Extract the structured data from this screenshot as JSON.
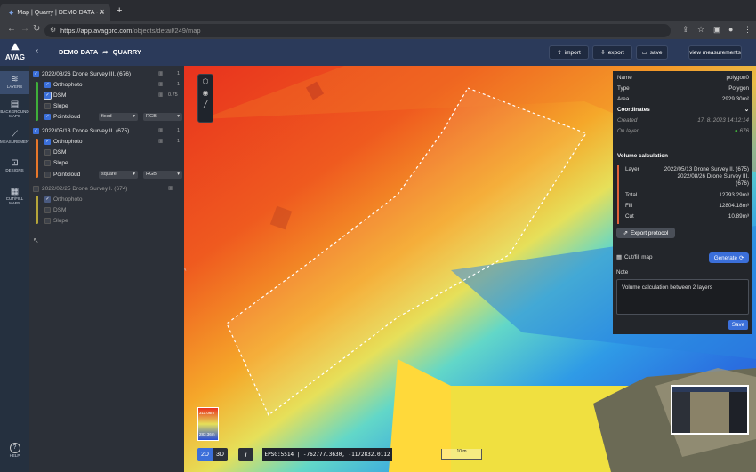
{
  "browser": {
    "tab_title": "Map | Quarry | DEMO DATA - A",
    "url_host": "https://app.avagpro.com",
    "url_path": "/objects/detail/249/map"
  },
  "colors": {
    "header": "#2b3a5a",
    "accent": "#3b6fd9",
    "survey1": "#3fae3a",
    "survey2": "#e8772a",
    "survey3": "#b5a53a"
  },
  "header": {
    "logo": "AVAG",
    "crumb_project": "DEMO DATA",
    "crumb_object": "QUARRY",
    "import_label": "import",
    "export_label": "export",
    "save_label": "save",
    "view_measurements_label": "view measurements"
  },
  "rail": {
    "layers": "LAYERS",
    "background_maps": "BACKGROUND MAPS",
    "measurements": "MEASUREMENTS",
    "designs": "DESIGNS",
    "cutfill_maps": "CUT/FILL MAPS",
    "help": "HELP"
  },
  "layers": [
    {
      "title": "2022/08/26 Drone Survey III. (676)",
      "count": "1",
      "items": [
        {
          "label": "Orthophoto",
          "value": "1"
        },
        {
          "label": "DSM",
          "value": "0.75"
        },
        {
          "label": "Slope",
          "value": ""
        },
        {
          "label": "Pointcloud",
          "mode": "fixed",
          "color": "RGB"
        }
      ]
    },
    {
      "title": "2022/05/13 Drone Survey II. (675)",
      "count": "1",
      "items": [
        {
          "label": "Orthophoto",
          "value": "1"
        },
        {
          "label": "DSM",
          "value": ""
        },
        {
          "label": "Slope",
          "value": ""
        },
        {
          "label": "Pointcloud",
          "mode": "square",
          "color": "RGB"
        }
      ]
    },
    {
      "title": "2022/02/25 Drone Survey I. (674)",
      "count": "",
      "items": [
        {
          "label": "Orthophoto",
          "value": ""
        },
        {
          "label": "DSM",
          "value": ""
        },
        {
          "label": "Slope",
          "value": ""
        }
      ]
    }
  ],
  "map": {
    "legend_max": "311.06m",
    "legend_min": "283.36m",
    "mode_2d": "2D",
    "mode_3d": "3D",
    "info_icon": "i",
    "coords": "EPSG:5514 | -762777.3630, -1172832.0112",
    "scale": "10 m"
  },
  "info": {
    "name_label": "Name",
    "name_value": "polygon0",
    "type_label": "Type",
    "type_value": "Polygon",
    "area_label": "Area",
    "area_value": "2929.30m²",
    "coordinates_label": "Coordinates",
    "created_label": "Created",
    "created_value": "17. 8. 2023 14:12:14",
    "onlayer_label": "On layer",
    "onlayer_value": "676",
    "volume_title": "Volume calculation",
    "layer_label": "Layer",
    "layer_value1": "2022/05/13 Drone Survey II. (675)",
    "layer_value2": "2022/08/26 Drone Survey III.",
    "layer_value3": "(676)",
    "total_label": "Total",
    "total_value": "12793.29m³",
    "fill_label": "Fill",
    "fill_value": "12804.18m³",
    "cut_label": "Cut",
    "cut_value": "10.89m³",
    "export_protocol": "Export protocol",
    "cutfill_label": "Cut/fill map",
    "generate_label": "Generate",
    "note_label": "Note",
    "note_value": "Volume calculation between 2 layers",
    "save_label": "Save"
  }
}
